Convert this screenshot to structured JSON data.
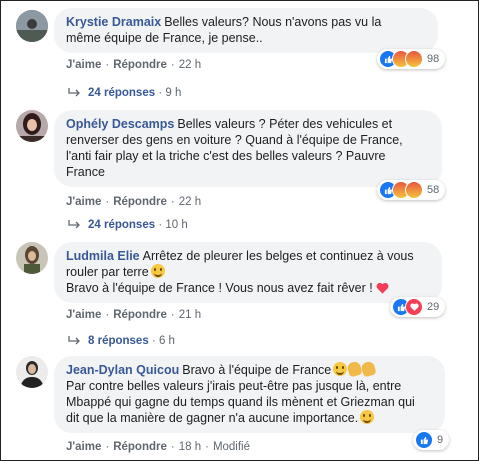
{
  "actions": {
    "like": "J'aime",
    "reply": "Répondre",
    "edited": "Modifié"
  },
  "comments": [
    {
      "author": "Krystie Dramaix",
      "lines": [
        "Belles valeurs? Nous n'avons pas vu la",
        "même équipe de France, je pense.."
      ],
      "time": "22 h",
      "reactions": {
        "icons": [
          "like-icon",
          "angry-icon",
          "angry-icon"
        ],
        "count": "98"
      },
      "replies": {
        "label": "24 réponses",
        "time": "9 h"
      }
    },
    {
      "author": "Ophély Descamps",
      "lines": [
        "Belles valeurs ? Péter des vehicules et",
        "renverser des gens en voiture ? Quand à l'équipe de France,",
        "l'anti fair play et la triche c'est des belles valeurs ? Pauvre",
        "France"
      ],
      "time": "22 h",
      "reactions": {
        "icons": [
          "like-icon",
          "angry-icon",
          "angry-icon"
        ],
        "count": "58"
      },
      "replies": {
        "label": "24 réponses",
        "time": "10 h"
      }
    },
    {
      "author": "Ludmila Elie",
      "lines": [
        "Arrêtez de pleurer les belges et continuez à vous",
        "rouler par terre",
        "Bravo à l'équipe de France ! Vous nous avez fait rêver !"
      ],
      "time": "21 h",
      "reactions": {
        "icons": [
          "like-icon",
          "love-icon"
        ],
        "count": "29"
      },
      "replies": {
        "label": "8 réponses",
        "time": "6 h"
      }
    },
    {
      "author": "Jean-Dylan Quicou",
      "lines": [
        "Bravo à l'équipe de France",
        "Par contre belles valeurs j'irais peut-être pas jusque là, entre",
        "Mbappé qui gagne du temps quand ils mènent et Griezman qui",
        "dit que la manière de gagner n'a aucune importance."
      ],
      "time": "18 h",
      "reactions": {
        "icons": [
          "like-icon"
        ],
        "count": "9"
      }
    }
  ],
  "colors": {
    "author": "#385898",
    "bubble": "#f2f3f5",
    "text": "#1c1e21",
    "muted": "#606770",
    "like": "#1877f2",
    "love": "#f33e58"
  }
}
